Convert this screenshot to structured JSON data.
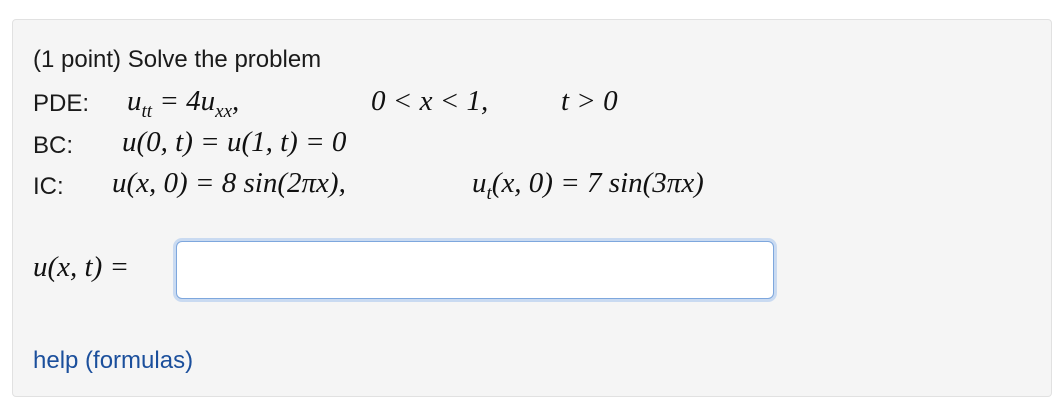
{
  "problem": {
    "title": "(1 point) Solve the problem",
    "pde": {
      "label": "PDE:",
      "u": "u",
      "u_sub": "tt",
      "eq_coef": " = 4u",
      "rhs_sub": "xx",
      "comma": ",",
      "domain_x": "0 < x < 1,",
      "domain_t": "t > 0"
    },
    "bc": {
      "label": "BC:",
      "equation": "u(0, t) = u(1, t) = 0"
    },
    "ic": {
      "label": "IC:",
      "first": "u(x, 0) = 8 sin(2πx),",
      "second_u": "u",
      "second_sub": "t",
      "second_rest": "(x, 0) = 7 sin(3πx)"
    }
  },
  "answer": {
    "label": "u(x, t) =",
    "value": "",
    "placeholder": ""
  },
  "help": {
    "label": "help (formulas)"
  }
}
